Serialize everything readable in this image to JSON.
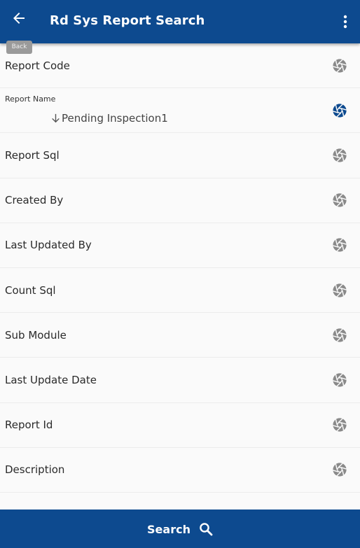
{
  "header": {
    "title": "Rd Sys Report Search",
    "back_tooltip": "Back",
    "back_icon": "arrow-left-icon",
    "menu_icon": "more-vert-icon",
    "color": "#0d4a8f"
  },
  "fields": [
    {
      "label": "Report Code",
      "icon": "aperture-icon",
      "active": false
    },
    {
      "label": "Report Name",
      "value": "Pending Inspection1",
      "sort_icon": "arrow-down-icon",
      "icon": "aperture-icon",
      "active": true
    },
    {
      "label": "Report Sql",
      "icon": "aperture-icon",
      "active": false
    },
    {
      "label": "Created By",
      "icon": "aperture-icon",
      "active": false
    },
    {
      "label": "Last Updated By",
      "icon": "aperture-icon",
      "active": false
    },
    {
      "label": "Count Sql",
      "icon": "aperture-icon",
      "active": false
    },
    {
      "label": "Sub Module",
      "icon": "aperture-icon",
      "active": false
    },
    {
      "label": "Last Update Date",
      "icon": "aperture-icon",
      "active": false
    },
    {
      "label": "Report Id",
      "icon": "aperture-icon",
      "active": false
    },
    {
      "label": "Description",
      "icon": "aperture-icon",
      "active": false
    }
  ],
  "footer": {
    "search_label": "Search",
    "search_icon": "search-icon"
  },
  "colors": {
    "primary": "#0d4a8f",
    "icon_inactive": "#8a8a8a",
    "icon_active": "#0d4a8f"
  }
}
